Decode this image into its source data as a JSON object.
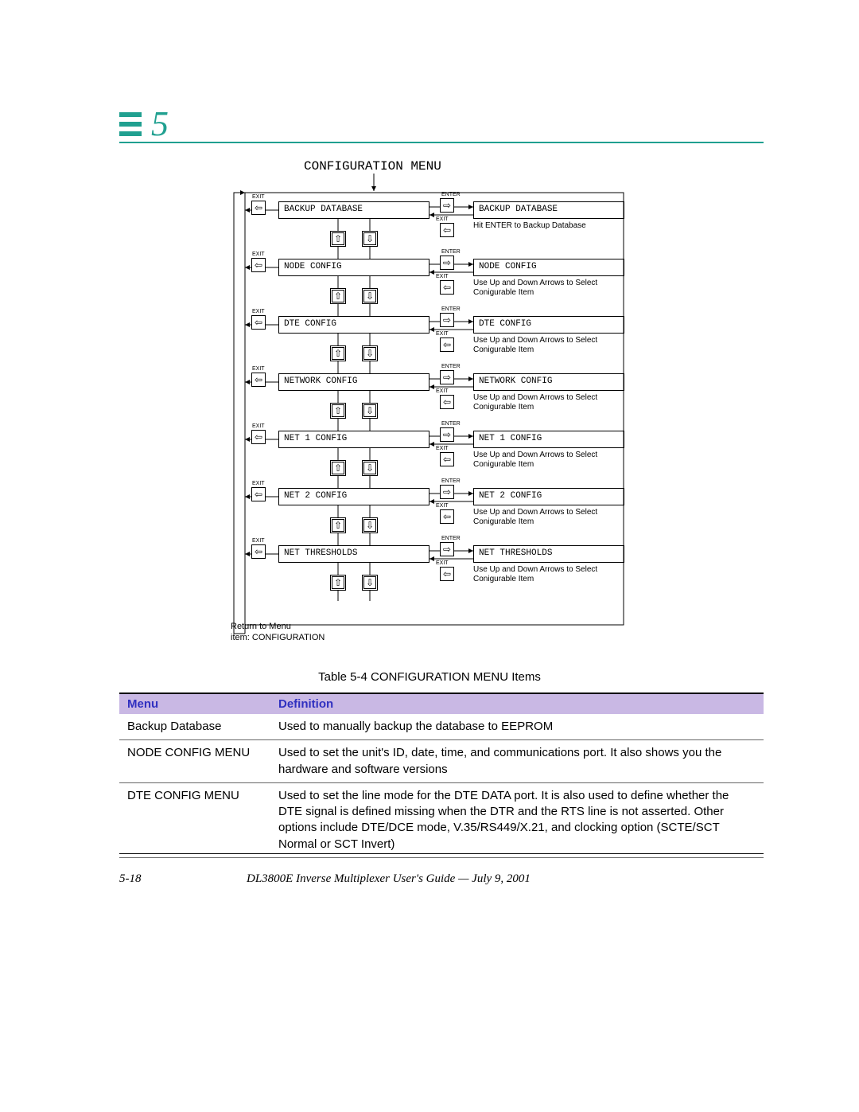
{
  "chapter_number": "5",
  "diagram_title": "CONFIGURATION MENU",
  "menu_items": [
    {
      "label": "BACKUP DATABASE",
      "right": "BACKUP DATABASE",
      "hint": "Hit ENTER to Backup Database"
    },
    {
      "label": "NODE CONFIG",
      "right": "NODE CONFIG",
      "hint": "Use Up and Down Arrows to Select Conigurable Item"
    },
    {
      "label": "DTE CONFIG",
      "right": "DTE  CONFIG",
      "hint": "Use Up and Down Arrows to Select Conigurable Item"
    },
    {
      "label": "NETWORK CONFIG",
      "right": "NETWORK CONFIG",
      "hint": "Use Up and Down Arrows to Select Conigurable Item"
    },
    {
      "label": "NET 1 CONFIG",
      "right": "NET 1 CONFIG",
      "hint": "Use Up and Down Arrows to Select Conigurable Item"
    },
    {
      "label": "NET 2 CONFIG",
      "right": "NET 2 CONFIG",
      "hint": "Use Up and Down Arrows to Select Conigurable Item"
    },
    {
      "label": "NET THRESHOLDS",
      "right": "NET THRESHOLDS",
      "hint": "Use Up and Down Arrows to Select Conigurable Item"
    }
  ],
  "labels": {
    "exit": "EXIT",
    "enter": "ENTER"
  },
  "return_note_line1": "Return to Menu",
  "return_note_line2": "item: CONFIGURATION",
  "table_caption": "Table 5-4    CONFIGURATION MENU Items",
  "table_headers": {
    "menu": "Menu",
    "definition": "Definition"
  },
  "table_rows": [
    {
      "menu": "Backup Database",
      "definition": "Used to manually backup the database to EEPROM"
    },
    {
      "menu": "NODE CONFIG MENU",
      "definition": "Used to set the unit's ID, date, time, and communications port. It also shows you the hardware and software versions"
    },
    {
      "menu": "DTE CONFIG MENU",
      "definition": "Used to set the line mode for the DTE DATA port. It is also used to define whether the DTE signal is defined missing when the DTR and the RTS line is not asserted. Other options include DTE/DCE mode, V.35/RS449/X.21, and clocking option (SCTE/SCT Normal or SCT Invert)"
    }
  ],
  "footer": {
    "page": "5-18",
    "title": "DL3800E Inverse Multiplexer User's Guide — July 9, 2001"
  }
}
